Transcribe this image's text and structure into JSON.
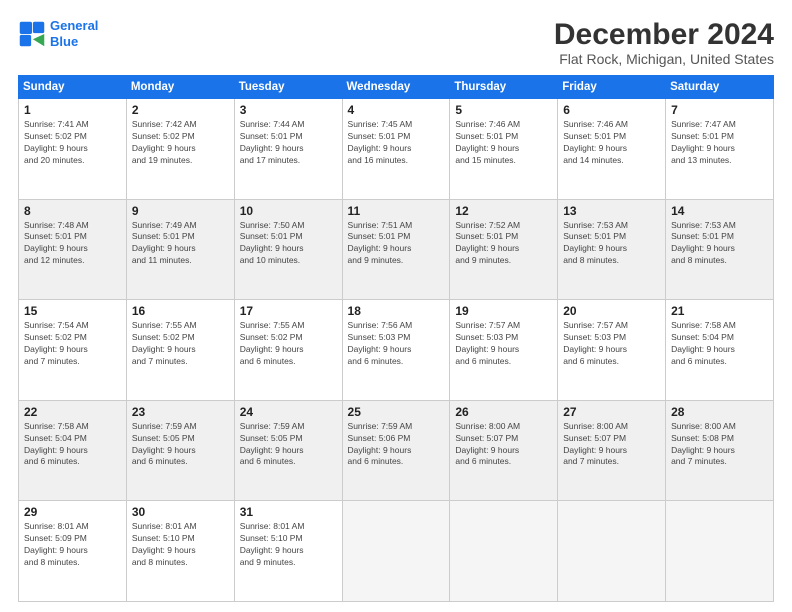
{
  "header": {
    "logo_line1": "General",
    "logo_line2": "Blue",
    "title": "December 2024",
    "subtitle": "Flat Rock, Michigan, United States"
  },
  "days_of_week": [
    "Sunday",
    "Monday",
    "Tuesday",
    "Wednesday",
    "Thursday",
    "Friday",
    "Saturday"
  ],
  "weeks": [
    {
      "shaded": false,
      "cells": [
        {
          "day": "1",
          "lines": [
            "Sunrise: 7:41 AM",
            "Sunset: 5:02 PM",
            "Daylight: 9 hours",
            "and 20 minutes."
          ]
        },
        {
          "day": "2",
          "lines": [
            "Sunrise: 7:42 AM",
            "Sunset: 5:02 PM",
            "Daylight: 9 hours",
            "and 19 minutes."
          ]
        },
        {
          "day": "3",
          "lines": [
            "Sunrise: 7:44 AM",
            "Sunset: 5:01 PM",
            "Daylight: 9 hours",
            "and 17 minutes."
          ]
        },
        {
          "day": "4",
          "lines": [
            "Sunrise: 7:45 AM",
            "Sunset: 5:01 PM",
            "Daylight: 9 hours",
            "and 16 minutes."
          ]
        },
        {
          "day": "5",
          "lines": [
            "Sunrise: 7:46 AM",
            "Sunset: 5:01 PM",
            "Daylight: 9 hours",
            "and 15 minutes."
          ]
        },
        {
          "day": "6",
          "lines": [
            "Sunrise: 7:46 AM",
            "Sunset: 5:01 PM",
            "Daylight: 9 hours",
            "and 14 minutes."
          ]
        },
        {
          "day": "7",
          "lines": [
            "Sunrise: 7:47 AM",
            "Sunset: 5:01 PM",
            "Daylight: 9 hours",
            "and 13 minutes."
          ]
        }
      ]
    },
    {
      "shaded": true,
      "cells": [
        {
          "day": "8",
          "lines": [
            "Sunrise: 7:48 AM",
            "Sunset: 5:01 PM",
            "Daylight: 9 hours",
            "and 12 minutes."
          ]
        },
        {
          "day": "9",
          "lines": [
            "Sunrise: 7:49 AM",
            "Sunset: 5:01 PM",
            "Daylight: 9 hours",
            "and 11 minutes."
          ]
        },
        {
          "day": "10",
          "lines": [
            "Sunrise: 7:50 AM",
            "Sunset: 5:01 PM",
            "Daylight: 9 hours",
            "and 10 minutes."
          ]
        },
        {
          "day": "11",
          "lines": [
            "Sunrise: 7:51 AM",
            "Sunset: 5:01 PM",
            "Daylight: 9 hours",
            "and 9 minutes."
          ]
        },
        {
          "day": "12",
          "lines": [
            "Sunrise: 7:52 AM",
            "Sunset: 5:01 PM",
            "Daylight: 9 hours",
            "and 9 minutes."
          ]
        },
        {
          "day": "13",
          "lines": [
            "Sunrise: 7:53 AM",
            "Sunset: 5:01 PM",
            "Daylight: 9 hours",
            "and 8 minutes."
          ]
        },
        {
          "day": "14",
          "lines": [
            "Sunrise: 7:53 AM",
            "Sunset: 5:01 PM",
            "Daylight: 9 hours",
            "and 8 minutes."
          ]
        }
      ]
    },
    {
      "shaded": false,
      "cells": [
        {
          "day": "15",
          "lines": [
            "Sunrise: 7:54 AM",
            "Sunset: 5:02 PM",
            "Daylight: 9 hours",
            "and 7 minutes."
          ]
        },
        {
          "day": "16",
          "lines": [
            "Sunrise: 7:55 AM",
            "Sunset: 5:02 PM",
            "Daylight: 9 hours",
            "and 7 minutes."
          ]
        },
        {
          "day": "17",
          "lines": [
            "Sunrise: 7:55 AM",
            "Sunset: 5:02 PM",
            "Daylight: 9 hours",
            "and 6 minutes."
          ]
        },
        {
          "day": "18",
          "lines": [
            "Sunrise: 7:56 AM",
            "Sunset: 5:03 PM",
            "Daylight: 9 hours",
            "and 6 minutes."
          ]
        },
        {
          "day": "19",
          "lines": [
            "Sunrise: 7:57 AM",
            "Sunset: 5:03 PM",
            "Daylight: 9 hours",
            "and 6 minutes."
          ]
        },
        {
          "day": "20",
          "lines": [
            "Sunrise: 7:57 AM",
            "Sunset: 5:03 PM",
            "Daylight: 9 hours",
            "and 6 minutes."
          ]
        },
        {
          "day": "21",
          "lines": [
            "Sunrise: 7:58 AM",
            "Sunset: 5:04 PM",
            "Daylight: 9 hours",
            "and 6 minutes."
          ]
        }
      ]
    },
    {
      "shaded": true,
      "cells": [
        {
          "day": "22",
          "lines": [
            "Sunrise: 7:58 AM",
            "Sunset: 5:04 PM",
            "Daylight: 9 hours",
            "and 6 minutes."
          ]
        },
        {
          "day": "23",
          "lines": [
            "Sunrise: 7:59 AM",
            "Sunset: 5:05 PM",
            "Daylight: 9 hours",
            "and 6 minutes."
          ]
        },
        {
          "day": "24",
          "lines": [
            "Sunrise: 7:59 AM",
            "Sunset: 5:05 PM",
            "Daylight: 9 hours",
            "and 6 minutes."
          ]
        },
        {
          "day": "25",
          "lines": [
            "Sunrise: 7:59 AM",
            "Sunset: 5:06 PM",
            "Daylight: 9 hours",
            "and 6 minutes."
          ]
        },
        {
          "day": "26",
          "lines": [
            "Sunrise: 8:00 AM",
            "Sunset: 5:07 PM",
            "Daylight: 9 hours",
            "and 6 minutes."
          ]
        },
        {
          "day": "27",
          "lines": [
            "Sunrise: 8:00 AM",
            "Sunset: 5:07 PM",
            "Daylight: 9 hours",
            "and 7 minutes."
          ]
        },
        {
          "day": "28",
          "lines": [
            "Sunrise: 8:00 AM",
            "Sunset: 5:08 PM",
            "Daylight: 9 hours",
            "and 7 minutes."
          ]
        }
      ]
    },
    {
      "shaded": false,
      "cells": [
        {
          "day": "29",
          "lines": [
            "Sunrise: 8:01 AM",
            "Sunset: 5:09 PM",
            "Daylight: 9 hours",
            "and 8 minutes."
          ]
        },
        {
          "day": "30",
          "lines": [
            "Sunrise: 8:01 AM",
            "Sunset: 5:10 PM",
            "Daylight: 9 hours",
            "and 8 minutes."
          ]
        },
        {
          "day": "31",
          "lines": [
            "Sunrise: 8:01 AM",
            "Sunset: 5:10 PM",
            "Daylight: 9 hours",
            "and 9 minutes."
          ]
        },
        {
          "day": "",
          "lines": []
        },
        {
          "day": "",
          "lines": []
        },
        {
          "day": "",
          "lines": []
        },
        {
          "day": "",
          "lines": []
        }
      ]
    }
  ]
}
